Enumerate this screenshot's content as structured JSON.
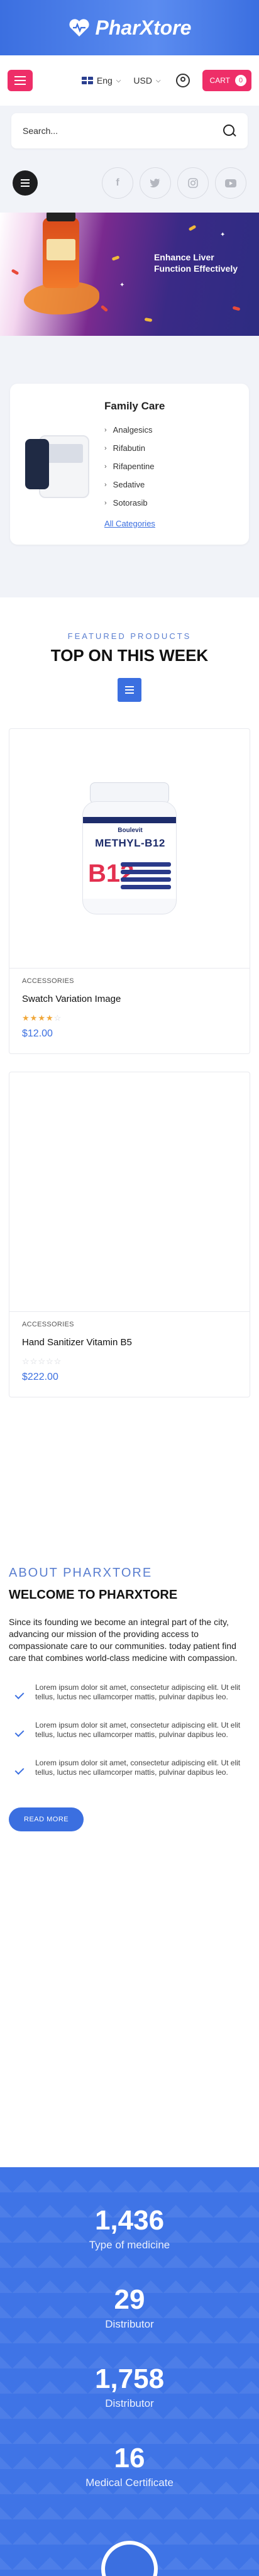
{
  "header": {
    "logo_text": "PharXtore",
    "colors": {
      "brand_blue": "#3b6fe0",
      "accent_pink": "#ee2e68"
    }
  },
  "nav": {
    "language": "Eng",
    "currency": "USD",
    "cart_label": "CART",
    "cart_count": "0"
  },
  "search": {
    "placeholder": "Search..."
  },
  "social": [
    "facebook-icon",
    "twitter-icon",
    "instagram-icon",
    "youtube-icon"
  ],
  "hero": {
    "line1": "Enhance Liver",
    "line2": "Function Effectively"
  },
  "family_care": {
    "title": "Family Care",
    "items": [
      "Analgesics",
      "Rifabutin",
      "Rifapentine",
      "Sedative",
      "Sotorasib"
    ],
    "link": "All Categories"
  },
  "featured": {
    "subtitle": "FEATURED PRODUCTS",
    "title": "TOP ON THIS WEEK",
    "products": [
      {
        "category": "ACCESSORIES",
        "name": "Swatch Variation Image",
        "rating": 4,
        "price": "$12.00",
        "bottle_brand": "Boulevit",
        "bottle_name": "METHYL-B12",
        "bottle_mark": "B12"
      },
      {
        "category": "ACCESSORIES",
        "name": "Hand Sanitizer Vitamin B5",
        "rating": 0,
        "price": "$222.00"
      }
    ]
  },
  "about": {
    "subtitle": "ABOUT PHARXTORE",
    "title": "WELCOME TO PHARXTORE",
    "text": "Since its founding we become an integral part of the city, advancing our mission of the providing access to compassionate care to our communities. today patient find care that combines world-class medicine with compassion.",
    "checks": [
      "Lorem ipsum dolor sit amet, consectetur adipiscing elit. Ut elit tellus, luctus nec ullamcorper mattis, pulvinar dapibus leo.",
      "Lorem ipsum dolor sit amet, consectetur adipiscing elit. Ut elit tellus, luctus nec ullamcorper mattis, pulvinar dapibus leo.",
      "Lorem ipsum dolor sit amet, consectetur adipiscing elit. Ut elit tellus, luctus nec ullamcorper mattis, pulvinar dapibus leo."
    ],
    "button": "READ MORE"
  },
  "stats": [
    {
      "number": "1,436",
      "label": "Type of medicine"
    },
    {
      "number": "29",
      "label": "Distributor"
    },
    {
      "number": "1,758",
      "label": "Distributor"
    },
    {
      "number": "16",
      "label": "Medical Certificate"
    }
  ]
}
